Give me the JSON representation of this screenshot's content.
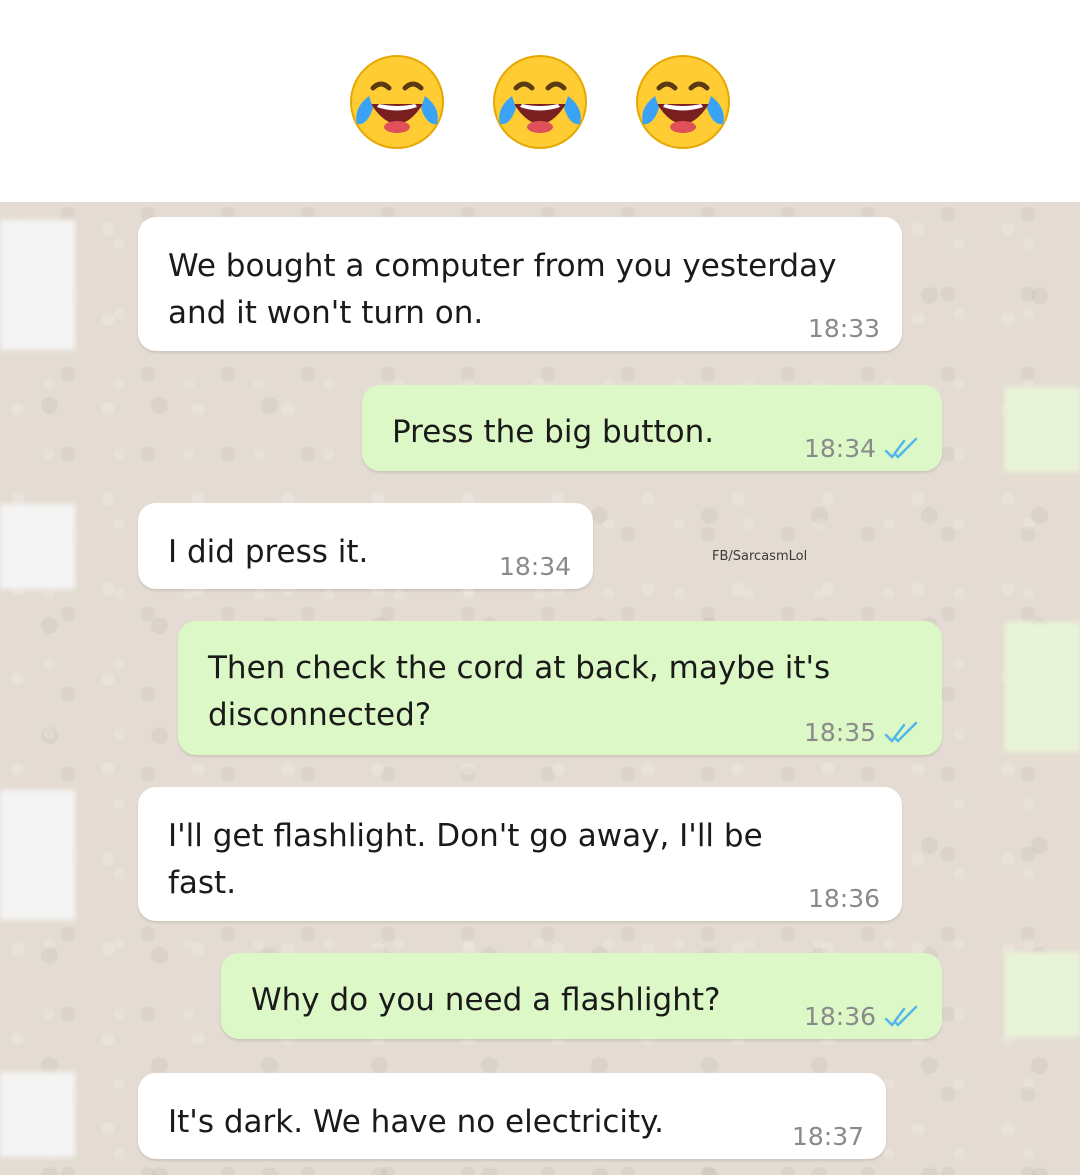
{
  "header": {
    "emojis": [
      "face-with-tears-of-joy-icon",
      "face-with-tears-of-joy-icon",
      "face-with-tears-of-joy-icon"
    ]
  },
  "watermark": "FB/SarcasmLol",
  "messages": [
    {
      "direction": "incoming",
      "text": "We bought a computer from you yesterday\nand it won't turn on.",
      "time": "18:33"
    },
    {
      "direction": "outgoing",
      "text": "Press the big button.",
      "time": "18:34",
      "status": "read"
    },
    {
      "direction": "incoming",
      "text": "I did press it.",
      "time": "18:34"
    },
    {
      "direction": "outgoing",
      "text": "Then check the cord at back, maybe it's\ndisconnected?",
      "time": "18:35",
      "status": "read"
    },
    {
      "direction": "incoming",
      "text": "I'll get flashlight. Don't go away, I'll be\nfast.",
      "time": "18:36"
    },
    {
      "direction": "outgoing",
      "text": "Why do you need a flashlight?",
      "time": "18:36",
      "status": "read"
    },
    {
      "direction": "incoming",
      "text": "It's dark. We have no electricity.",
      "time": "18:37"
    }
  ],
  "colors": {
    "incoming_bubble": "#ffffff",
    "outgoing_bubble": "#dcf8c6",
    "chat_background": "#e4dcd2",
    "read_ticks": "#4fb6ec",
    "time_text": "#8a8a8a"
  }
}
